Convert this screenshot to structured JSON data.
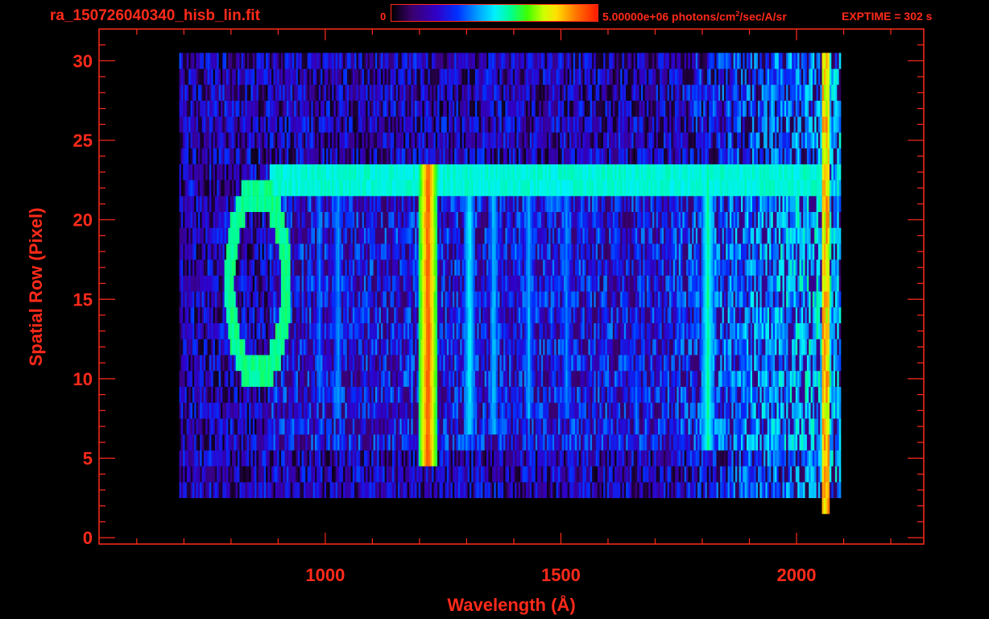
{
  "header": {
    "file_title": "ra_150726040340_hisb_lin.fit",
    "colorbar_min": "0",
    "colorbar_max_prefix": "5.00000e+06 photons/cm",
    "colorbar_max_exp": "2",
    "colorbar_max_suffix": "/sec/A/sr",
    "exptime": "EXPTIME = 302 s"
  },
  "colors": {
    "axis": "#ff2a1a",
    "background": "#000000"
  },
  "chart_data": {
    "type": "heatmap",
    "xlabel": "Wavelength (Å)",
    "ylabel": "Spatial Row (Pixel)",
    "xlim": [
      520,
      2270
    ],
    "ylim": [
      -0.4,
      32
    ],
    "x_ticks": [
      {
        "value": 1000,
        "label": "1000"
      },
      {
        "value": 1500,
        "label": "1500"
      },
      {
        "value": 2000,
        "label": "2000"
      }
    ],
    "y_ticks": [
      {
        "value": 0,
        "label": "0"
      },
      {
        "value": 5,
        "label": "5"
      },
      {
        "value": 10,
        "label": "10"
      },
      {
        "value": 15,
        "label": "15"
      },
      {
        "value": 20,
        "label": "20"
      },
      {
        "value": 25,
        "label": "25"
      },
      {
        "value": 30,
        "label": "30"
      }
    ],
    "x_minor_step": 100,
    "y_minor_step": 1,
    "colorbar_range": [
      0,
      5000000
    ],
    "background_region": {
      "x": [
        690,
        2090
      ],
      "rows": [
        3,
        30
      ]
    },
    "slit_region": {
      "x": [
        880,
        2070
      ],
      "rows": [
        6,
        23
      ]
    },
    "emission_lines": [
      {
        "x": 1216,
        "rows": [
          5,
          23
        ],
        "intensity": 0.92,
        "width": 40
      },
      {
        "x": 1304,
        "rows": [
          7,
          23
        ],
        "intensity": 0.5,
        "width": 22
      },
      {
        "x": 1356,
        "rows": [
          7,
          23
        ],
        "intensity": 0.45,
        "width": 18
      },
      {
        "x": 1430,
        "rows": [
          8,
          23
        ],
        "intensity": 0.42,
        "width": 18
      },
      {
        "x": 1510,
        "rows": [
          8,
          22
        ],
        "intensity": 0.38,
        "width": 18
      },
      {
        "x": 1025,
        "rows": [
          8,
          22
        ],
        "intensity": 0.4,
        "width": 18
      },
      {
        "x": 985,
        "rows": [
          9,
          22
        ],
        "intensity": 0.38,
        "width": 14
      },
      {
        "x": 1810,
        "rows": [
          6,
          23
        ],
        "intensity": 0.55,
        "width": 26
      }
    ],
    "continuum_band": {
      "x": [
        880,
        2060
      ],
      "row": 22.5,
      "intensity": 0.5
    },
    "ring": {
      "cx": 855,
      "cy": 16,
      "rx": 60,
      "ry": 5.8,
      "intensity": 0.55
    },
    "edge": {
      "x": 2060,
      "rows": [
        2,
        30
      ],
      "intensity": 0.7
    }
  }
}
